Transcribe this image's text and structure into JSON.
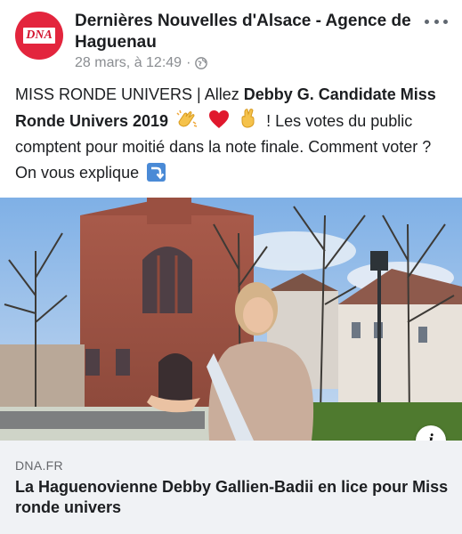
{
  "post": {
    "page_name": "Dernières Nouvelles d'Alsace - Agence de Haguenau",
    "avatar_text": "DNA",
    "timestamp": "28 mars, à 12:49",
    "separator": "·",
    "privacy_icon": "globe-icon",
    "more_icon": "more-horizontal-icon",
    "text": {
      "part1": "MISS RONDE UNIVERS | Allez ",
      "bold": "Debby G. Candidate Miss Ronde Univers 2019",
      "emojis": [
        "clapping-hands-emoji",
        "red-heart-emoji",
        "crossed-fingers-emoji"
      ],
      "part2": " ! Les votes du public comptent pour moitié dans la note finale. Comment voter ? On vous explique",
      "arrow_emoji": "right-arrow-curving-down-emoji"
    }
  },
  "link_preview": {
    "image_alt": "Woman wearing a Miss sash standing in front of a brick church",
    "info_icon": "info-icon",
    "domain": "DNA.FR",
    "title": "La Haguenovienne Debby Gallien-Badii en lice pour Miss ronde univers"
  },
  "colors": {
    "avatar_bg": "#e3253d",
    "text_primary": "#1c1e21",
    "text_secondary": "#8a8d91",
    "card_bg": "#f0f2f5"
  }
}
